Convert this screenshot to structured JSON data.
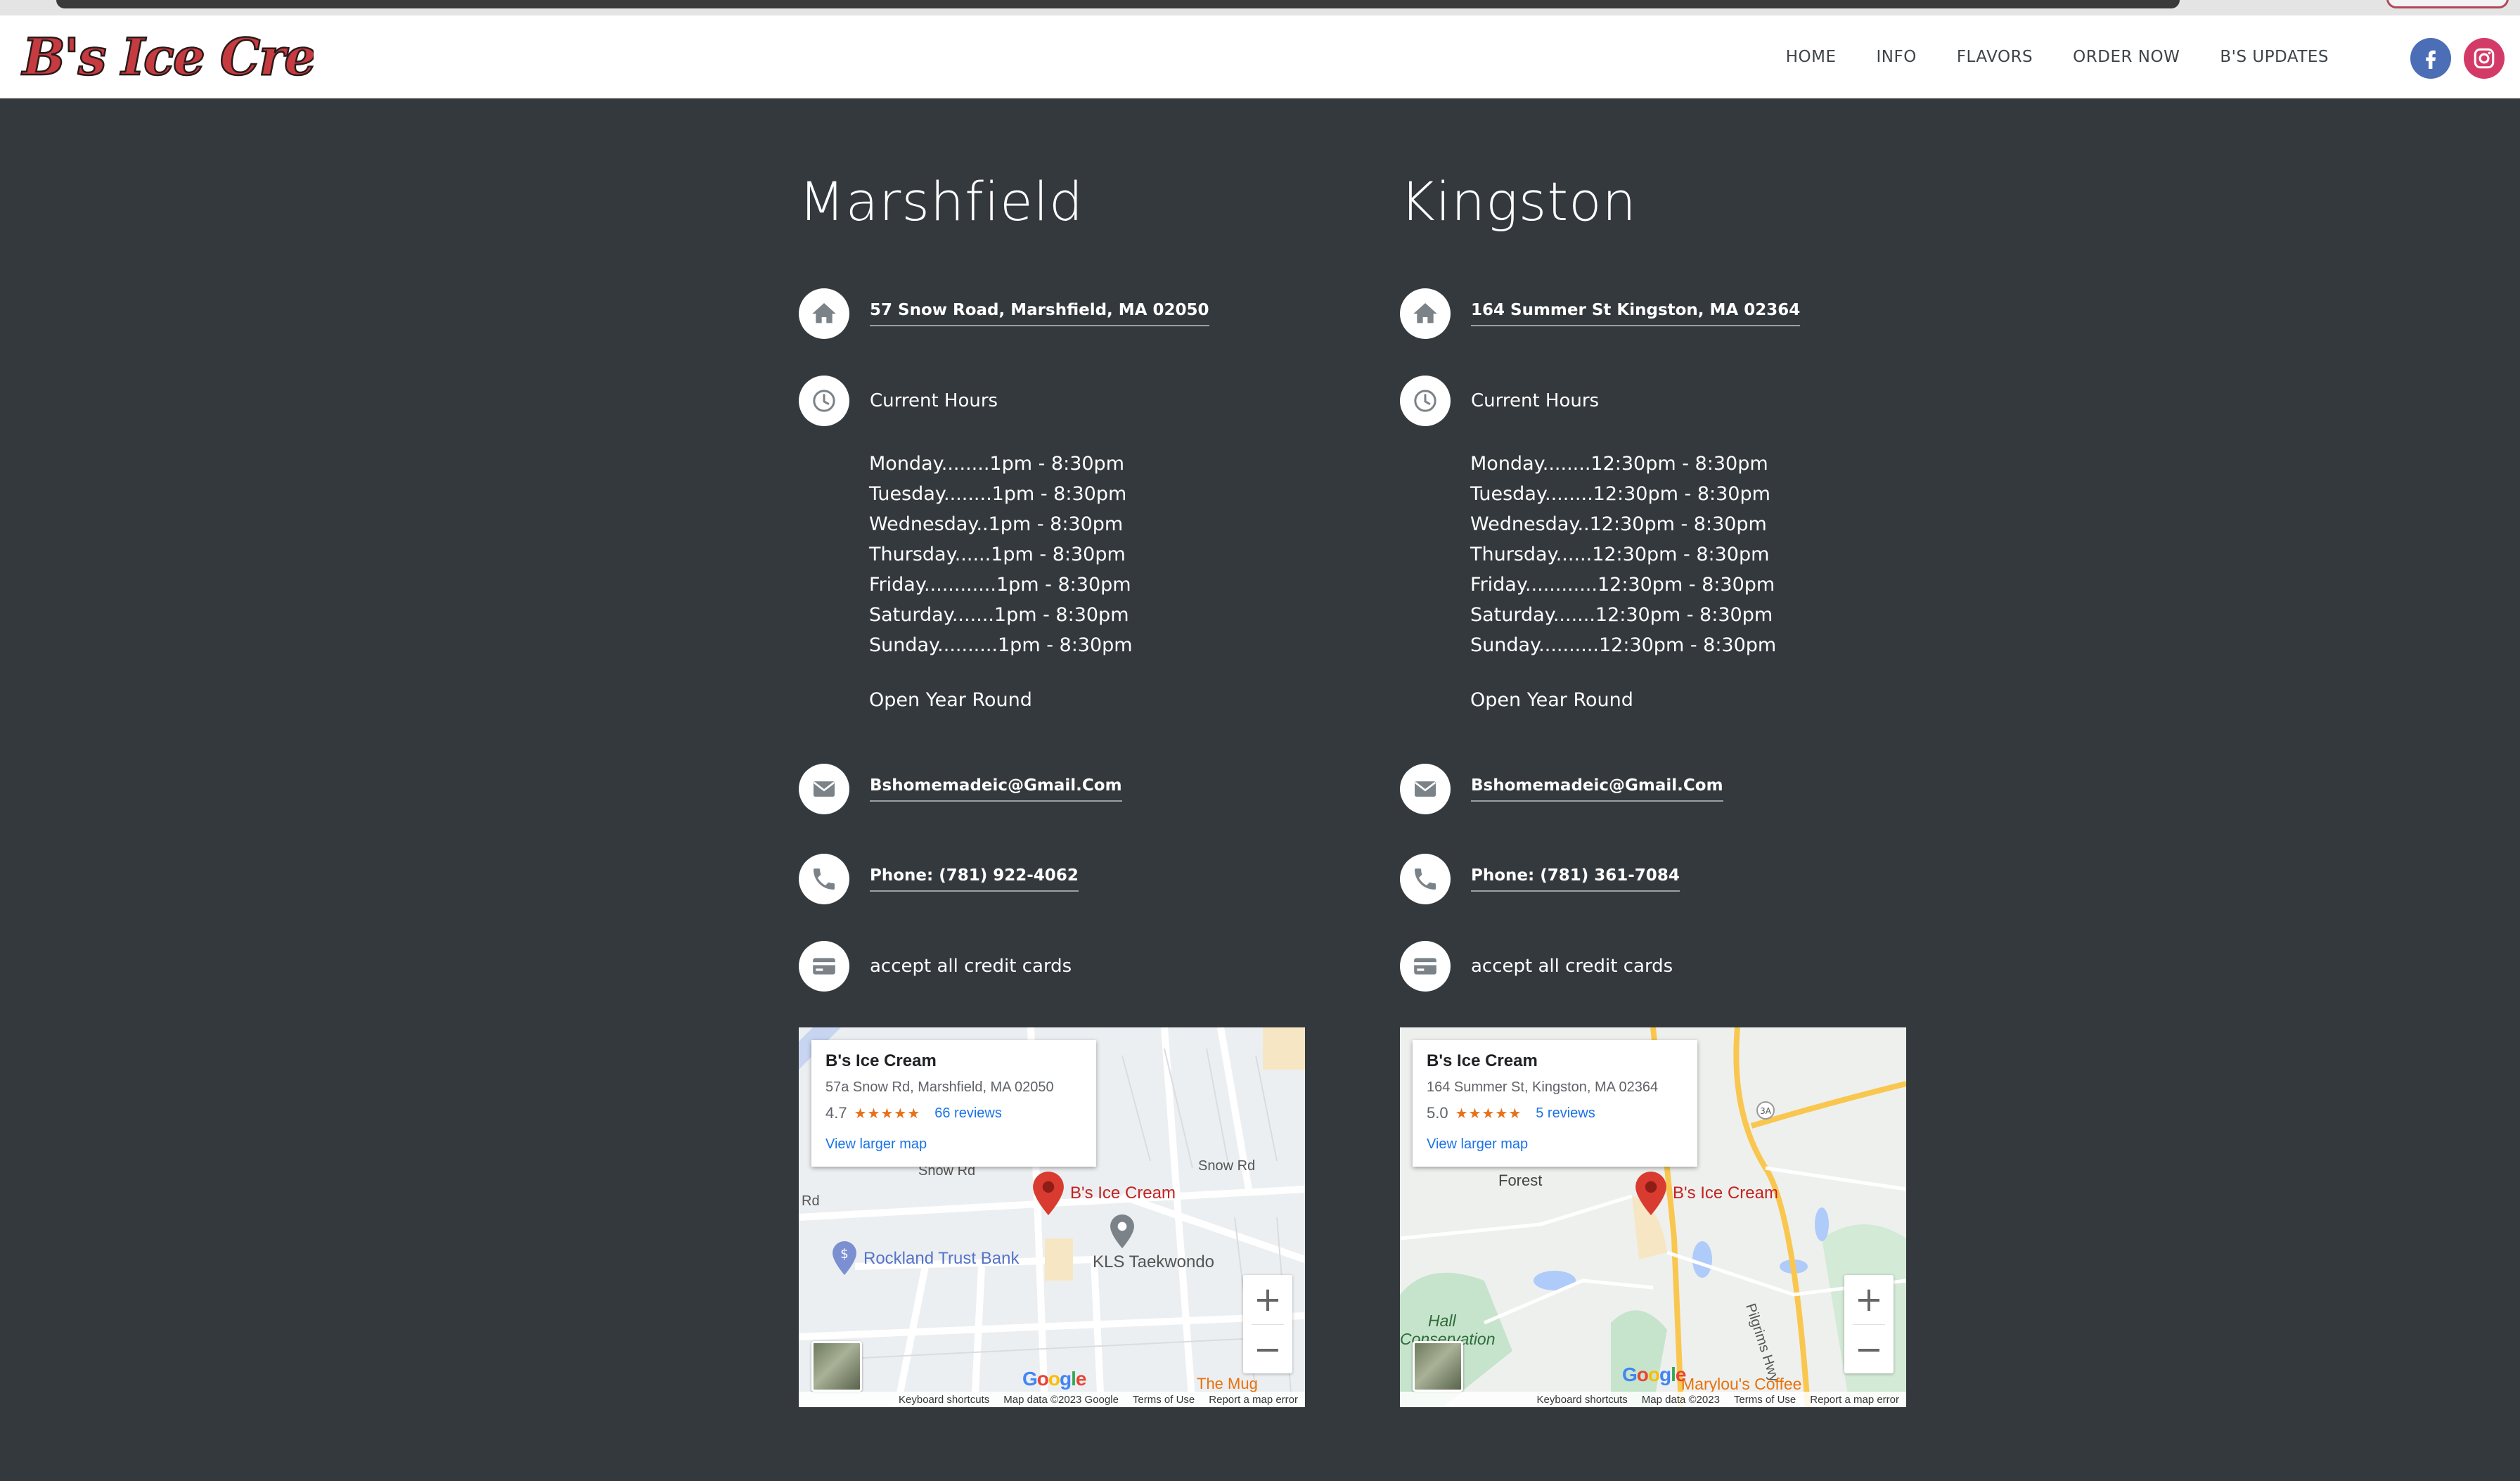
{
  "brand": {
    "logo_text": "B's Ice Cream"
  },
  "nav": {
    "links": [
      "HOME",
      "INFO",
      "FLAVORS",
      "ORDER NOW",
      "B'S UPDATES"
    ],
    "social": [
      "facebook-icon",
      "instagram-icon"
    ]
  },
  "colors": {
    "background": "#33393d",
    "facebook": "#4b6eb6",
    "instagram": "#d43a68",
    "pin": "#d93b30"
  },
  "locations": [
    {
      "city": "Marshfield",
      "address": "57 Snow Road, Marshfield, MA 02050",
      "hours_title": "Current Hours",
      "hours": [
        "Monday........1pm - 8:30pm",
        "Tuesday........1pm - 8:30pm",
        "Wednesday..1pm - 8:30pm",
        "Thursday......1pm - 8:30pm",
        "Friday............1pm - 8:30pm",
        "Saturday.......1pm - 8:30pm",
        "Sunday..........1pm - 8:30pm"
      ],
      "season": "Open Year Round",
      "email": "Bshomemadeic@Gmail.Com",
      "phone": "Phone: (781) 922-4062",
      "payment": "accept all credit cards",
      "map": {
        "place": "B's Ice Cream",
        "address": "57a Snow Rd, Marshfield, MA 02050",
        "rating": "4.7",
        "stars": "★★★★★",
        "reviews": "66 reviews",
        "larger_map": "View larger map",
        "labels": [
          "Snow Rd",
          "Snow Rd",
          "Rd",
          "B's Ice Cream",
          "Rockland Trust Bank",
          "KLS Taekwondo",
          "The Mug"
        ],
        "footer": [
          "Keyboard shortcuts",
          "Map data ©2023 Google",
          "Terms of Use",
          "Report a map error"
        ]
      }
    },
    {
      "city": "Kingston",
      "address": "164 Summer St Kingston, MA 02364",
      "hours_title": "Current Hours",
      "hours": [
        "Monday........12:30pm - 8:30pm",
        "Tuesday........12:30pm - 8:30pm",
        "Wednesday..12:30pm - 8:30pm",
        "Thursday......12:30pm - 8:30pm",
        "Friday............12:30pm - 8:30pm",
        "Saturday.......12:30pm - 8:30pm",
        "Sunday..........12:30pm - 8:30pm"
      ],
      "season": "Open Year Round",
      "email": "Bshomemadeic@Gmail.Com",
      "phone": "Phone: (781) 361-7084",
      "payment": "accept all credit cards",
      "map": {
        "place": "B's Ice Cream",
        "address": "164 Summer St, Kingston, MA 02364",
        "rating": "5.0",
        "stars": "★★★★★",
        "reviews": "5 reviews",
        "larger_map": "View larger map",
        "labels": [
          "Forest",
          "B's Ice Cream",
          "Hall",
          "Conservation",
          "Pilgrims Hwy",
          "Marylou's Coffee",
          "3A"
        ],
        "footer": [
          "Keyboard shortcuts",
          "Map data ©2023",
          "Terms of Use",
          "Report a map error"
        ]
      }
    }
  ]
}
